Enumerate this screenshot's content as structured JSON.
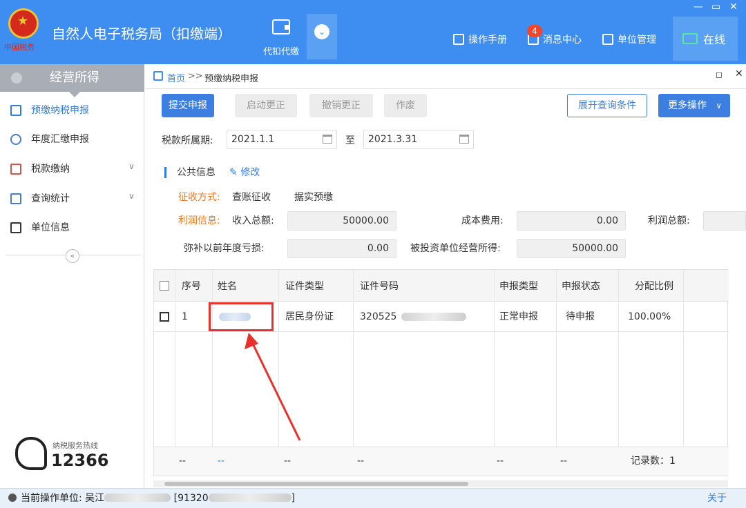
{
  "header": {
    "title": "自然人电子税务局（扣缴端）",
    "logo_text": "中国税务",
    "nav_withhold": "代扣代缴",
    "manual": "操作手册",
    "messages": "消息中心",
    "message_count": "4",
    "unit_mgmt": "单位管理",
    "online": "在线"
  },
  "sidebar": {
    "title": "经营所得",
    "items": [
      {
        "label": "预缴纳税申报",
        "icon": "form-icon",
        "active": true
      },
      {
        "label": "年度汇缴申报",
        "icon": "yuan-icon"
      },
      {
        "label": "税款缴纳",
        "icon": "payment-icon",
        "expand": "∨"
      },
      {
        "label": "查询统计",
        "icon": "report-icon",
        "expand": "∨"
      },
      {
        "label": "单位信息",
        "icon": "list-icon"
      }
    ],
    "collapse": "«",
    "hotline_label": "纳税服务热线",
    "hotline_number": "12366"
  },
  "breadcrumb": {
    "home": "首页",
    "sep": ">>",
    "current": "预缴纳税申报"
  },
  "toolbar": {
    "submit": "提交申报",
    "start_correct": "启动更正",
    "cancel_correct": "撤销更正",
    "void": "作废",
    "expand_query": "展开查询条件",
    "more": "更多操作"
  },
  "period": {
    "label": "税款所属期:",
    "from": "2021.1.1",
    "to_label": "至",
    "to": "2021.3.31"
  },
  "public_info": {
    "title": "公共信息",
    "edit": "修改",
    "collect_label": "征收方式:",
    "collect_value1": "查账征收",
    "collect_value2": "据实预缴",
    "profit_label": "利润信息:",
    "income_label": "收入总额:",
    "income_value": "50000.00",
    "cost_label": "成本费用:",
    "cost_value": "0.00",
    "profit_total_label": "利润总额:",
    "loss_label": "弥补以前年度亏损:",
    "loss_value": "0.00",
    "invest_label": "被投资单位经营所得:",
    "invest_value": "50000.00"
  },
  "table": {
    "columns": [
      "序号",
      "姓名",
      "证件类型",
      "证件号码",
      "申报类型",
      "申报状态",
      "分配比例"
    ],
    "rows": [
      {
        "index": "1",
        "id_type": "居民身份证",
        "id_prefix": "320525",
        "decl_type": "正常申报",
        "decl_status": "待申报",
        "ratio": "100.00%"
      }
    ],
    "footer": [
      "--",
      "--",
      "--",
      "--",
      "--",
      "--"
    ],
    "record_count": "记录数：1"
  },
  "statusbar": {
    "label": "当前操作单位:",
    "unit_prefix": "吴江",
    "code_prefix": "[91320",
    "code_suffix": "]",
    "about": "关于"
  },
  "colors": {
    "header_blue": "#3d8ef0",
    "primary_button": "#3d7fe0",
    "highlight_red": "#e8312a",
    "orange_label": "#e87b2a"
  }
}
